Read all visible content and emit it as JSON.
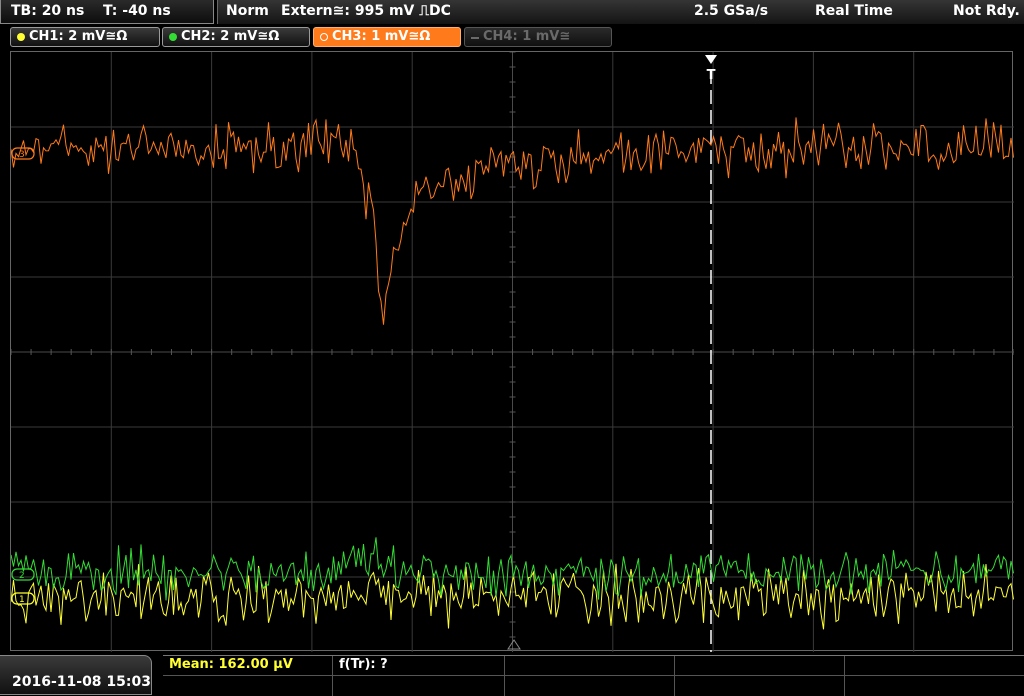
{
  "timebase": {
    "tb": "TB: 20 ns",
    "trigger_pos": "T: -40 ns"
  },
  "status": {
    "mode": "Norm",
    "trigger_source": "Extern≅: 995 mV ⎍DC",
    "sample_rate": "2.5 GSa/s",
    "acq_mode": "Real Time",
    "state": "Not Rdy."
  },
  "channels": [
    {
      "label": "CH1: 2 mV≅Ω",
      "color": "#ffff33",
      "state": "on"
    },
    {
      "label": "CH2: 2 mV≅Ω",
      "color": "#33dd33",
      "state": "on"
    },
    {
      "label": "CH3: 1 mV≅Ω",
      "color": "#ff7a1a",
      "state": "active"
    },
    {
      "label": "CH4: 1 mV≅",
      "color": "#6a6a6a",
      "state": "off"
    }
  ],
  "markers": {
    "trigger_marker": "T",
    "ch3_level": "3",
    "ch2_level": "2",
    "ch1_level": "1"
  },
  "footer": {
    "datetime": "2016-11-08 15:03",
    "mean": "Mean: 162.00 µV",
    "ftr": "f(Tr): ?"
  },
  "colors": {
    "ch1": "#ffff33",
    "ch2": "#33dd33",
    "ch3": "#ff7a1a",
    "grid": "#3a3a3a"
  }
}
